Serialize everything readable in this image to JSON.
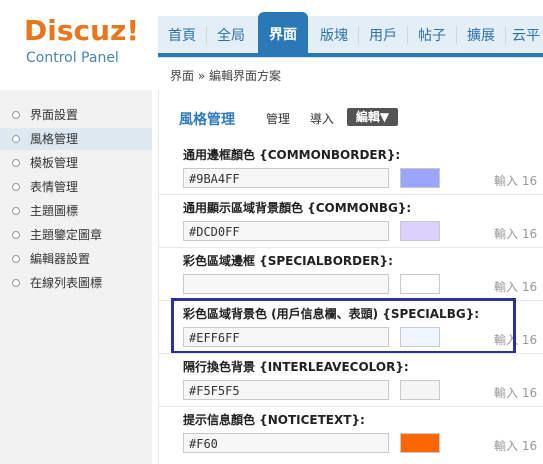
{
  "header": {
    "logo": "Discuz!",
    "logo_sub": "Control Panel",
    "tabs": [
      {
        "label": "首頁"
      },
      {
        "label": "全局"
      },
      {
        "label": "界面"
      },
      {
        "label": "版塊"
      },
      {
        "label": "用戶"
      },
      {
        "label": "帖子"
      },
      {
        "label": "擴展"
      },
      {
        "label": "云平"
      }
    ],
    "active_tab": "界面",
    "breadcrumb": "界面 » 編輯界面方案"
  },
  "sidebar": {
    "items": [
      {
        "label": "界面設置"
      },
      {
        "label": "風格管理"
      },
      {
        "label": "模板管理"
      },
      {
        "label": "表情管理"
      },
      {
        "label": "主題圖標"
      },
      {
        "label": "主題鑒定圖章"
      },
      {
        "label": "編輯器設置"
      },
      {
        "label": "在線列表圖標"
      }
    ],
    "active": "風格管理"
  },
  "main": {
    "title": "風格管理",
    "links": [
      "管理",
      "導入"
    ],
    "dropdown": "編輯▼",
    "fields": [
      {
        "label": "通用邊框顏色 {COMMONBORDER}:",
        "value": "#9BA4FF",
        "color": "#9BA4FF",
        "hint": "輸入 16"
      },
      {
        "label": "通用顯示區域背景顏色 {COMMONBG}:",
        "value": "#DCD0FF",
        "color": "#DCD0FF",
        "hint": "輸入 16"
      },
      {
        "label": "彩色區域邊框 {SPECIALBORDER}:",
        "value": "",
        "color": "#FFFFFF",
        "hint": "輸入 16"
      },
      {
        "label": "彩色區域背景色 (用戶信息欄、表頭) {SPECIALBG}:",
        "value": "#EFF6FF",
        "color": "#EFF6FF",
        "hint": "輸入 16"
      },
      {
        "label": "隔行換色背景 {INTERLEAVECOLOR}:",
        "value": "#F5F5F5",
        "color": "#F5F5F5",
        "hint": "輸入 16"
      },
      {
        "label": "提示信息顏色 {NOTICETEXT}:",
        "value": "#F60",
        "color": "#FF6600",
        "hint": "輸入 16"
      }
    ]
  },
  "colors": {
    "accent": "#2a79b6",
    "logo": "#e8761a",
    "highlight": "#2b2fa0"
  }
}
